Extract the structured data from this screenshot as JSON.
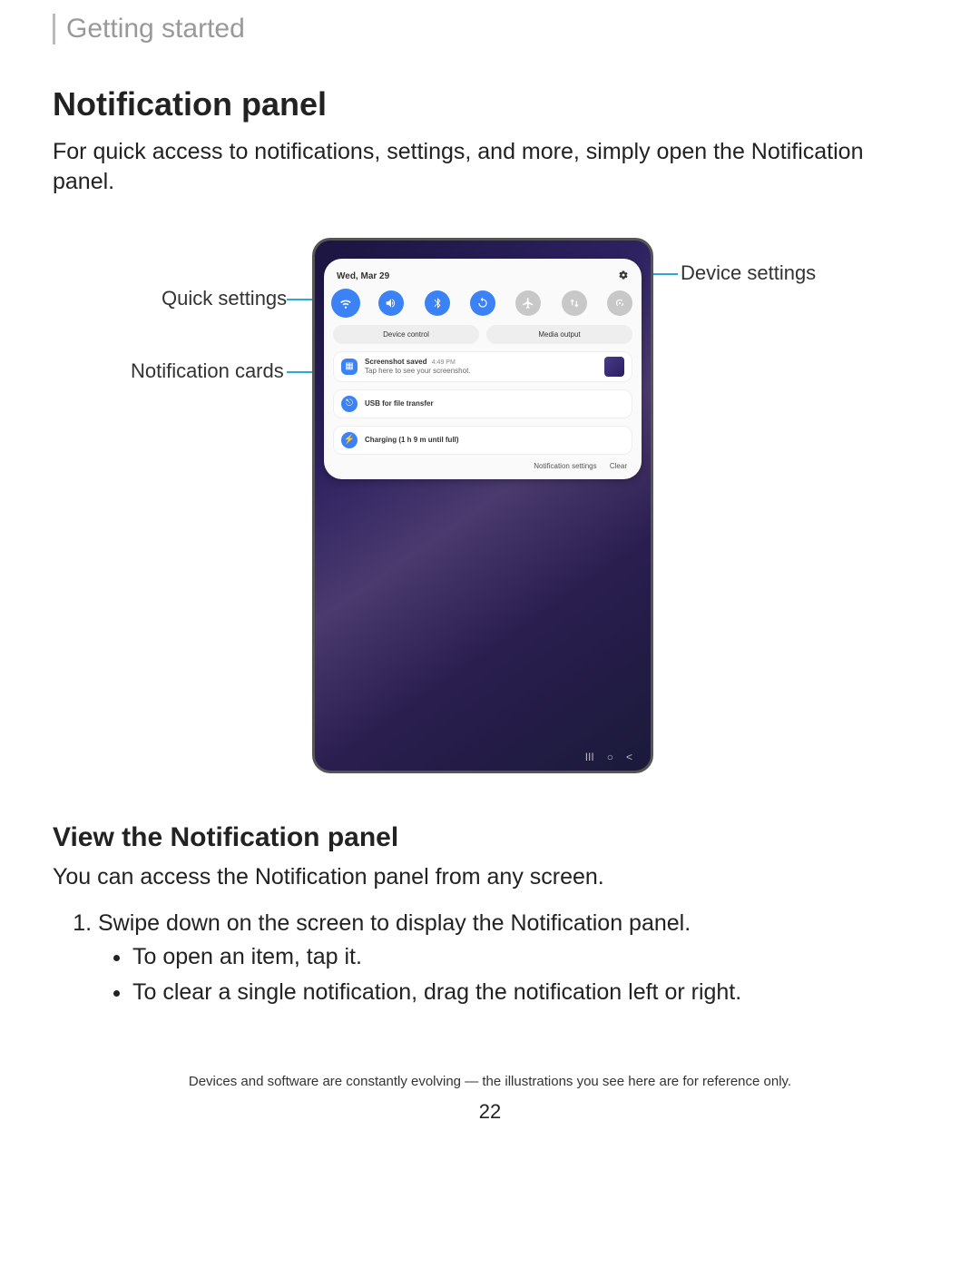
{
  "breadcrumb": "Getting started",
  "title": "Notification panel",
  "intro": "For quick access to notifications, settings, and more, simply open the Notification panel.",
  "callouts": {
    "quick_settings": "Quick settings",
    "notification_cards": "Notification cards",
    "device_settings": "Device settings"
  },
  "panel": {
    "date": "Wed, Mar 29",
    "buttons": {
      "device_control": "Device control",
      "media_output": "Media output"
    },
    "notifications": [
      {
        "title": "Screenshot saved",
        "time": "4:49 PM",
        "sub": "Tap here to see your screenshot."
      },
      {
        "title": "USB for file transfer"
      },
      {
        "title": "Charging (1 h 9 m until full)"
      }
    ],
    "links": {
      "settings": "Notification settings",
      "clear": "Clear"
    }
  },
  "section": {
    "heading": "View the Notification panel",
    "intro": "You can access the Notification panel from any screen.",
    "step1": "Swipe down on the screen to display the Notification panel.",
    "bullet1": "To open an item, tap it.",
    "bullet2": "To clear a single notification, drag the notification left or right."
  },
  "footnote": "Devices and software are constantly evolving — the illustrations you see here are for reference only.",
  "pagenum": "22"
}
